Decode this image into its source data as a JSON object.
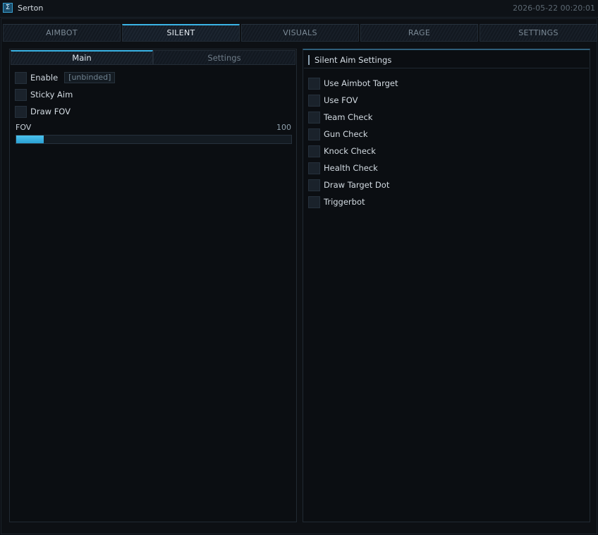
{
  "app": {
    "title": "Serton",
    "clock": "2026-05-22 00:20:01",
    "logo_glyph": "Σ"
  },
  "tabs": [
    {
      "label": "AIMBOT",
      "active": false
    },
    {
      "label": "SILENT",
      "active": true
    },
    {
      "label": "VISUALS",
      "active": false
    },
    {
      "label": "RAGE",
      "active": false
    },
    {
      "label": "SETTINGS",
      "active": false
    }
  ],
  "left_panel": {
    "subtabs": [
      {
        "label": "Main",
        "active": true
      },
      {
        "label": "Settings",
        "active": false
      }
    ],
    "enable": {
      "label": "Enable",
      "keybind": "[unbinded]",
      "checked": false
    },
    "sticky_aim": {
      "label": "Sticky Aim",
      "checked": false
    },
    "draw_fov": {
      "label": "Draw FOV",
      "checked": false
    },
    "fov_slider": {
      "label": "FOV",
      "value": "100",
      "fill_fraction": 0.1
    }
  },
  "right_panel": {
    "header": "Silent Aim Settings",
    "options": [
      {
        "label": "Use Aimbot Target",
        "checked": false
      },
      {
        "label": "Use FOV",
        "checked": false
      },
      {
        "label": "Team Check",
        "checked": false
      },
      {
        "label": "Gun Check",
        "checked": false
      },
      {
        "label": "Knock Check",
        "checked": false
      },
      {
        "label": "Health Check",
        "checked": false
      },
      {
        "label": "Draw Target Dot",
        "checked": false
      },
      {
        "label": "Triggerbot",
        "checked": false
      }
    ]
  },
  "colors": {
    "accent": "#3ab4e6",
    "background": "#0b0e12"
  }
}
